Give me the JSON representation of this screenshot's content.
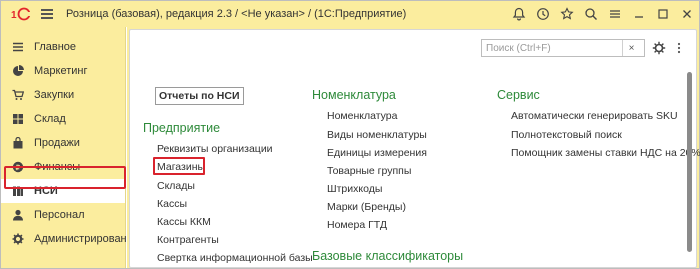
{
  "titlebar": {
    "title": "Розница (базовая), редакция 2.3 / <Не указан> /  (1С:Предприятие)",
    "logo_text": "1С",
    "icons": [
      "bell-icon",
      "history-icon",
      "star-icon",
      "search-icon",
      "menu-icon",
      "minimize-icon",
      "maximize-icon",
      "close-icon"
    ]
  },
  "sidebar": {
    "items": [
      {
        "label": "Главное",
        "icon": "menu-lines-icon"
      },
      {
        "label": "Маркетинг",
        "icon": "pie-chart-icon"
      },
      {
        "label": "Закупки",
        "icon": "cart-icon"
      },
      {
        "label": "Склад",
        "icon": "grid-icon"
      },
      {
        "label": "Продажи",
        "icon": "bag-icon"
      },
      {
        "label": "Финансы",
        "icon": "coin-icon"
      },
      {
        "label": "НСИ",
        "icon": "books-icon"
      },
      {
        "label": "Персонал",
        "icon": "person-icon"
      },
      {
        "label": "Администрирование",
        "icon": "gear-icon"
      }
    ],
    "active": "НСИ"
  },
  "search": {
    "placeholder": "Поиск (Ctrl+F)",
    "value": "",
    "clear_label": "×"
  },
  "main": {
    "reports_button": "Отчеты по НСИ",
    "columns": [
      {
        "title": "Предприятие",
        "links": [
          "Реквизиты организации",
          "Магазины",
          "Склады",
          "Кассы",
          "Кассы ККМ",
          "Контрагенты",
          "Свертка информационной базы"
        ]
      },
      {
        "title": "Номенклатура",
        "links": [
          "Номенклатура",
          "Виды номенклатуры",
          "Единицы измерения",
          "Товарные группы",
          "Штрихкоды",
          "Марки (Бренды)",
          "Номера ГТД"
        ]
      },
      {
        "title": "Сервис",
        "links": [
          "Автоматически генерировать SKU",
          "Полнотекстовый поиск",
          "Помощник замены ставки НДС на 20%"
        ]
      }
    ],
    "extra_group": "Базовые классификаторы"
  },
  "colors": {
    "accent_yellow": "#fbed9e",
    "group_green": "#2e8a3a",
    "highlight_red": "#d9232d",
    "logo_red": "#e3262c"
  }
}
